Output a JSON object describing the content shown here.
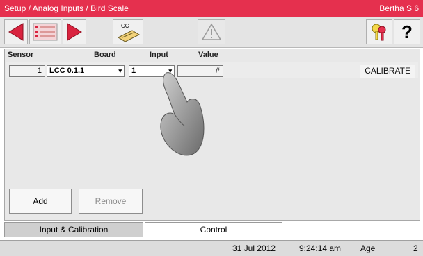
{
  "header": {
    "breadcrumb": "Setup / Analog Inputs / Bird Scale",
    "room": "Bertha S 6"
  },
  "toolbar": {
    "cc_label": "CC",
    "help_label": "?"
  },
  "table": {
    "columns": [
      "Sensor",
      "Board",
      "Input",
      "Value"
    ],
    "row": {
      "sensor": "1",
      "board": "LCC 0.1.1",
      "input": "1",
      "value": "#"
    },
    "calibrate_label": "CALIBRATE"
  },
  "actions": {
    "add_label": "Add",
    "remove_label": "Remove"
  },
  "tabs": [
    {
      "label": "Input & Calibration",
      "active": true
    },
    {
      "label": "Control",
      "active": false
    }
  ],
  "status": {
    "date": "31 Jul 2012",
    "time": "9:24:14 am",
    "age_label": "Age",
    "age_value": "2"
  },
  "colors": {
    "title_bar": "#e5304e",
    "arrow": "#d9233f"
  }
}
